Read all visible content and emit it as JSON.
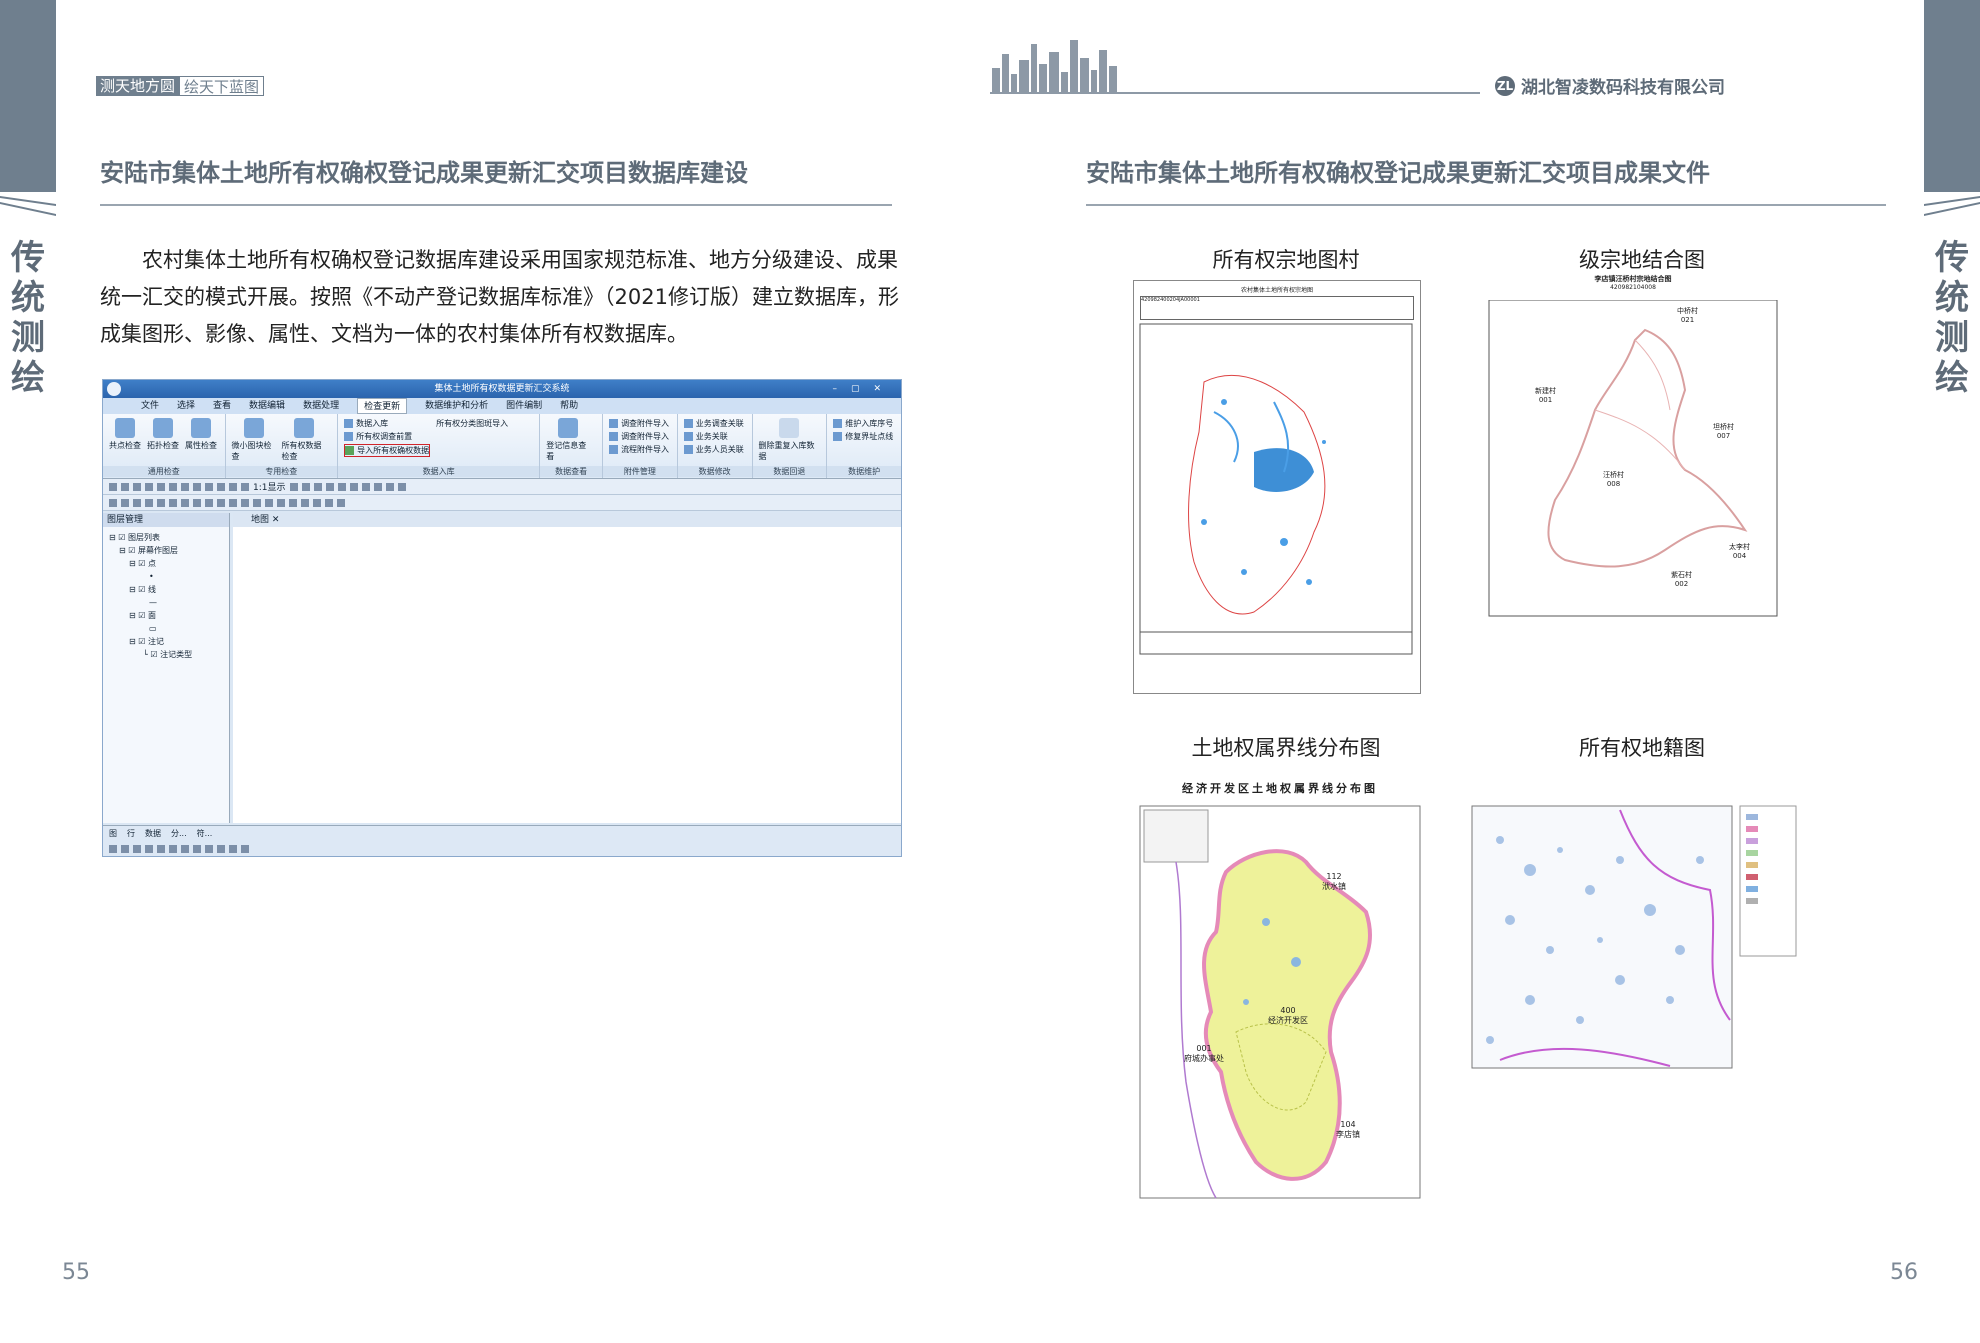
{
  "left_page": {
    "side_text": [
      "传",
      "统",
      "测",
      "绘"
    ],
    "slogan": {
      "part1": "测天地方圆",
      "part2": "绘天下蓝图"
    },
    "title": "安陆市集体土地所有权确权登记成果更新汇交项目数据库建设",
    "paragraph": "农村集体土地所有权确权登记数据库建设采用国家规范标准、地方分级建设、成果统一汇交的模式开展。按照《不动产登记数据库标准》（2021修订版）建立数据库，形成集图形、影像、属性、文档为一体的农村集体所有权数据库。",
    "page_number": "55",
    "screenshot": {
      "window_title": "集体土地所有权数据更新汇交系统",
      "menu": [
        "文件",
        "选择",
        "查看",
        "数据编辑",
        "数据处理",
        "检查更新",
        "数据维护和分析",
        "图件编制",
        "帮助"
      ],
      "active_menu_index": 5,
      "groups": [
        {
          "label": "通用检查",
          "buttons": [
            "共点检查",
            "拓扑检查",
            "属性检查"
          ]
        },
        {
          "label": "专用检查",
          "buttons": [
            "微小图块检查",
            "所有权数据检查"
          ]
        },
        {
          "label": "数据入库",
          "items": [
            "数据入库",
            "所有权调查前置",
            "导入所有权确权数据"
          ],
          "extra": "所有权分类图斑导入"
        },
        {
          "label": "数据查看",
          "buttons": [
            "登记信息查看"
          ]
        },
        {
          "label": "附件管理",
          "items": [
            "调查附件导入",
            "调查附件导入",
            "流程附件导入"
          ]
        },
        {
          "label": "数据修改",
          "items": [
            "业务调查关联",
            "业务关联",
            "业务人员关联"
          ]
        },
        {
          "label": "数据回退",
          "buttons": [
            "删除重复入库数据"
          ]
        },
        {
          "label": "数据维护",
          "items": [
            "维护入库序号",
            "修复界址点线"
          ]
        }
      ],
      "highlighted_item": "导入所有权确权数据",
      "panel_title": "图层管理",
      "layers": [
        "图层列表",
        "屏幕作图层",
        "点",
        "线",
        "面",
        "注记",
        "注记类型"
      ],
      "map_tab": "地图",
      "scale_text": "1:1显示",
      "bottom_tabs": [
        "图",
        "行",
        "数据",
        "分...",
        "符..."
      ]
    }
  },
  "right_page": {
    "side_text": [
      "传",
      "统",
      "测",
      "绘"
    ],
    "company": "湖北智凌数码科技有限公司",
    "company_logo": "ZL",
    "title": "安陆市集体土地所有权确权登记成果更新汇交项目成果文件",
    "page_number": "56",
    "figures": [
      {
        "caption": "所有权宗地图村",
        "inner_title": "农村集体土地所有权宗地图",
        "parcel_code": "420982400204JA00001"
      },
      {
        "caption": "级宗地结合图",
        "inner_title": "李店镇汪桥村宗地结合图",
        "inner_code": "420982104008",
        "villages": [
          {
            "name": "中桥村",
            "code": "021"
          },
          {
            "name": "新建村",
            "code": "001"
          },
          {
            "name": "汪桥村",
            "code": "008"
          },
          {
            "name": "坦桥村",
            "code": "007"
          },
          {
            "name": "太李村",
            "code": "004"
          },
          {
            "name": "紫石村",
            "code": "002"
          }
        ]
      },
      {
        "caption": "土地权属界线分布图",
        "inner_title": "经济开发区土地权属界线分布图",
        "areas": [
          {
            "code": "112",
            "name": "洑水镇"
          },
          {
            "code": "400",
            "name": "经济开发区"
          },
          {
            "code": "001",
            "name": "府城办事处"
          },
          {
            "code": "104",
            "name": "李店镇"
          }
        ]
      },
      {
        "caption": "所有权地籍图"
      }
    ]
  },
  "colors": {
    "accent": "#5e6b78",
    "sidebar": "#6f7f8e",
    "highlight_red": "#d0242a",
    "map_yellow": "#eef29a",
    "boundary_pink": "#e58ab8"
  }
}
